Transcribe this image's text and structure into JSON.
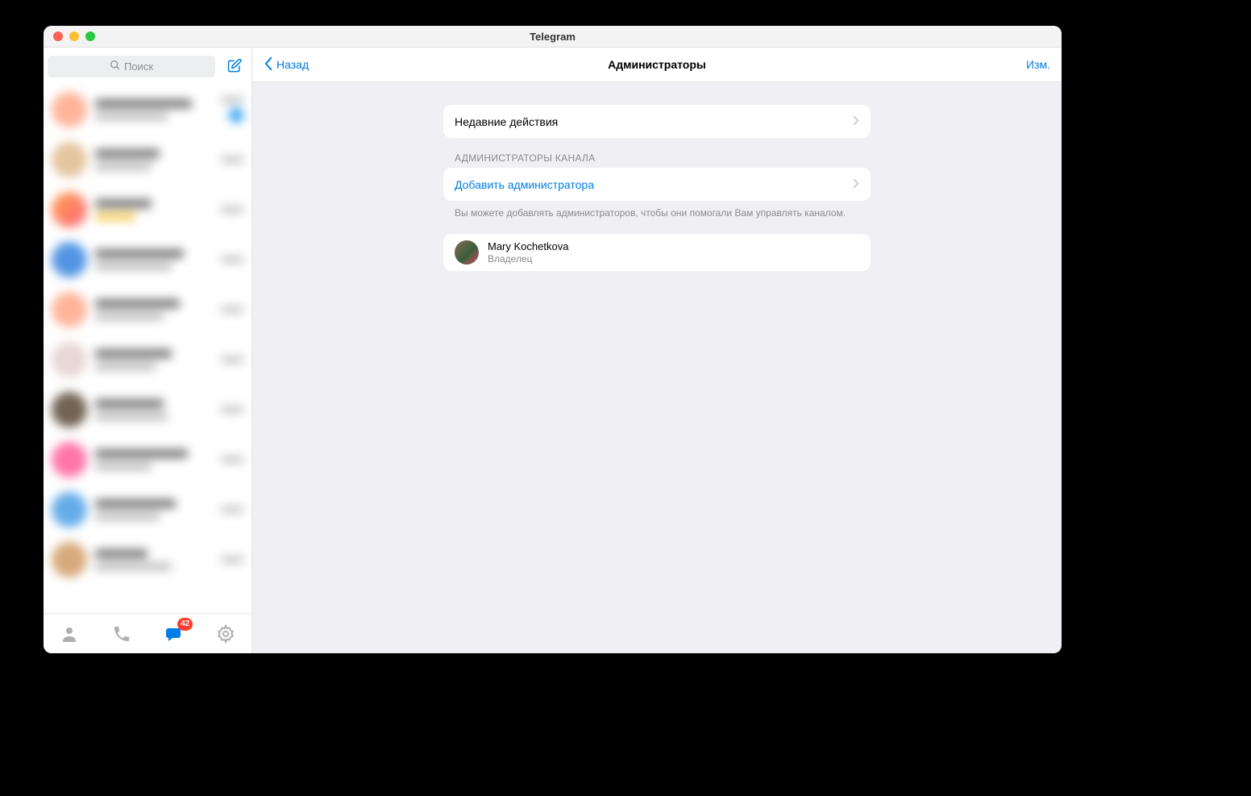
{
  "window": {
    "title": "Telegram"
  },
  "sidebar": {
    "search_placeholder": "Поиск",
    "tabs": {
      "chats_badge": "42"
    }
  },
  "header": {
    "back_label": "Назад",
    "title": "Администраторы",
    "edit_label": "Изм."
  },
  "panels": {
    "recent_actions": "Недавние действия",
    "admins_section_label": "АДМИНИСТРАТОРЫ КАНАЛА",
    "add_admin": "Добавить администратора",
    "admins_footer": "Вы можете добавлять администраторов, чтобы они помогали Вам управлять каналом."
  },
  "admins": [
    {
      "name": "Mary Kochetkova",
      "role": "Владелец"
    }
  ]
}
